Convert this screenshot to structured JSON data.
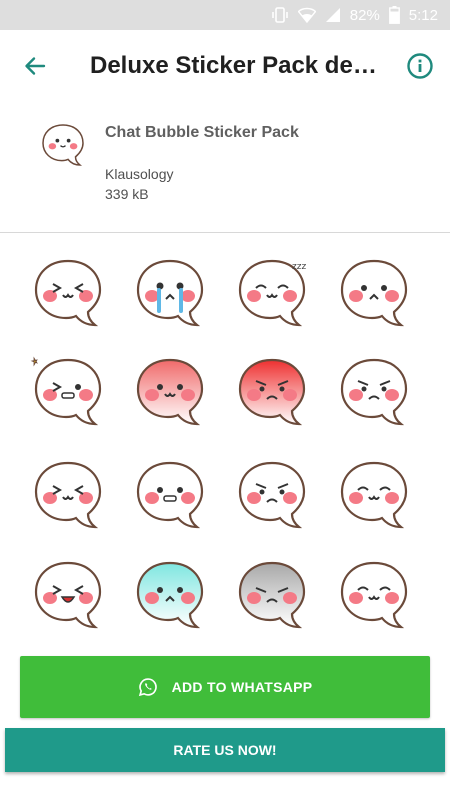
{
  "status_bar": {
    "battery_percent": "82%",
    "time": "5:12",
    "icons": [
      "vibrate-icon",
      "wifi-icon",
      "signal-icon",
      "battery-icon"
    ]
  },
  "app_bar": {
    "title": "Deluxe Sticker Pack det…",
    "back_icon": "arrow-back-icon",
    "info_icon": "info-icon"
  },
  "pack": {
    "name": "Chat Bubble Sticker Pack",
    "author": "Klausology",
    "size": "339 kB"
  },
  "stickers": [
    {
      "fill": "#ffffff",
      "mood": "squint"
    },
    {
      "fill": "#ffffff",
      "mood": "cry"
    },
    {
      "fill": "#ffffff",
      "mood": "sleep"
    },
    {
      "fill": "#ffffff",
      "mood": "shock"
    },
    {
      "fill": "#ffffff",
      "mood": "wink"
    },
    {
      "fill": "#f06a6a",
      "mood": "blush"
    },
    {
      "fill": "#ee3030",
      "mood": "angry"
    },
    {
      "fill": "#ffffff",
      "mood": "annoyed"
    },
    {
      "fill": "#ffffff",
      "mood": "happy"
    },
    {
      "fill": "#ffffff",
      "mood": "grin"
    },
    {
      "fill": "#ffffff",
      "mood": "mad"
    },
    {
      "fill": "#ffffff",
      "mood": "smile"
    },
    {
      "fill": "#ffffff",
      "mood": "laugh"
    },
    {
      "fill": "#7fe6e0",
      "mood": "scared"
    },
    {
      "fill": "#a8a8a8",
      "mood": "sad"
    },
    {
      "fill": "#ffffff",
      "mood": "content"
    }
  ],
  "actions": {
    "add_label": "ADD TO WHATSAPP",
    "add_icon": "whatsapp-icon",
    "rate_label": "RATE US NOW!"
  },
  "colors": {
    "accent": "#1f8a7e",
    "whatsapp_green": "#40bd3a",
    "rate_teal": "#1f9a8a",
    "blush": "#f47a86"
  }
}
